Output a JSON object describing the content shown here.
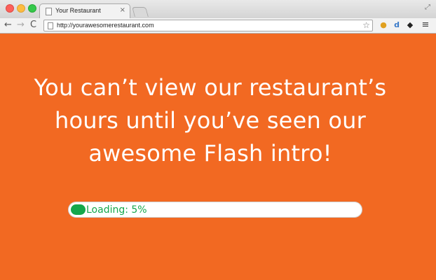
{
  "browser": {
    "tab_title": "Your Restaurant",
    "tab_close": "×",
    "url": "http://yourawesomerestaurant.com",
    "back": "←",
    "forward": "→",
    "reload": "C",
    "star": "☆",
    "menu": "≡"
  },
  "page": {
    "headline": "You can’t view our restaurant’s hours until you’ve seen our awesome Flash intro!",
    "background": "#f26922",
    "progress": {
      "label": "Loading: 5%",
      "percent": 5,
      "color": "#14a74b"
    }
  }
}
